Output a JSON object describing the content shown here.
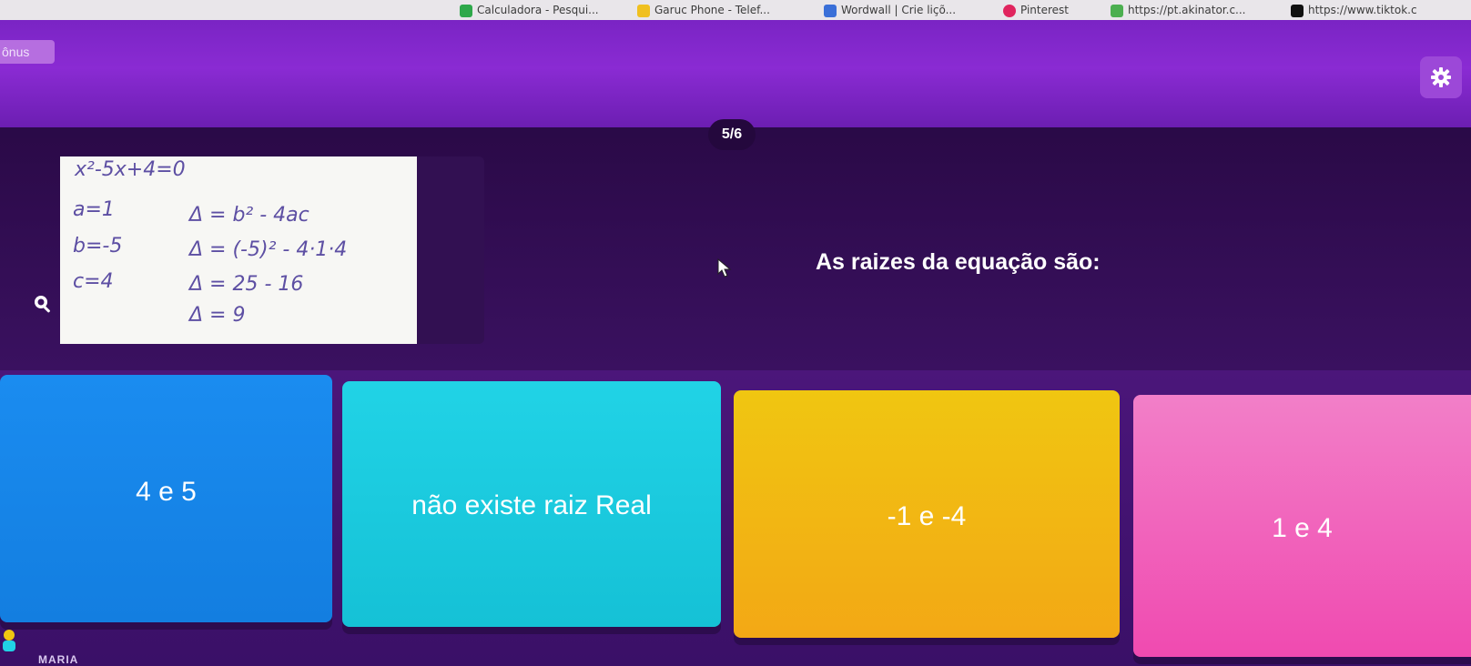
{
  "bookmarks": [
    {
      "label": "Calculadora - Pesqui...",
      "color": "#2ea84a"
    },
    {
      "label": "Garuc Phone - Telef...",
      "color": "#f0c020"
    },
    {
      "label": "Wordwall | Crie liçõ...",
      "color": "#3a6fd8"
    },
    {
      "label": "Pinterest",
      "color": "#e0245e"
    },
    {
      "label": "https://pt.akinator.c...",
      "color": "#4caf50"
    },
    {
      "label": "https://www.tiktok.c",
      "color": "#111111"
    }
  ],
  "header": {
    "bonus_label": "ônus",
    "counter": "5/6"
  },
  "question": {
    "text": "As raizes da equação são:",
    "image": {
      "equation": "x²-5x+4=0",
      "a": "a=1",
      "b": "b=-5",
      "c": "c=4",
      "step1": "Δ = b² - 4ac",
      "step2": "Δ = (-5)² - 4·1·4",
      "step3": "Δ = 25 - 16",
      "step4": "Δ = 9"
    }
  },
  "answers": [
    {
      "label": "4 e 5",
      "color": "#1a8cf0"
    },
    {
      "label": "não existe raiz Real",
      "color": "#21d3e6"
    },
    {
      "label": "-1 e -4",
      "color": "#f0c611"
    },
    {
      "label": "1 e 4",
      "color": "#f04ab0"
    }
  ],
  "player": {
    "name": "MARIA"
  },
  "icons": {
    "settings": "gear-icon",
    "zoom": "zoom-in-icon",
    "cursor": "mouse-pointer-icon"
  }
}
